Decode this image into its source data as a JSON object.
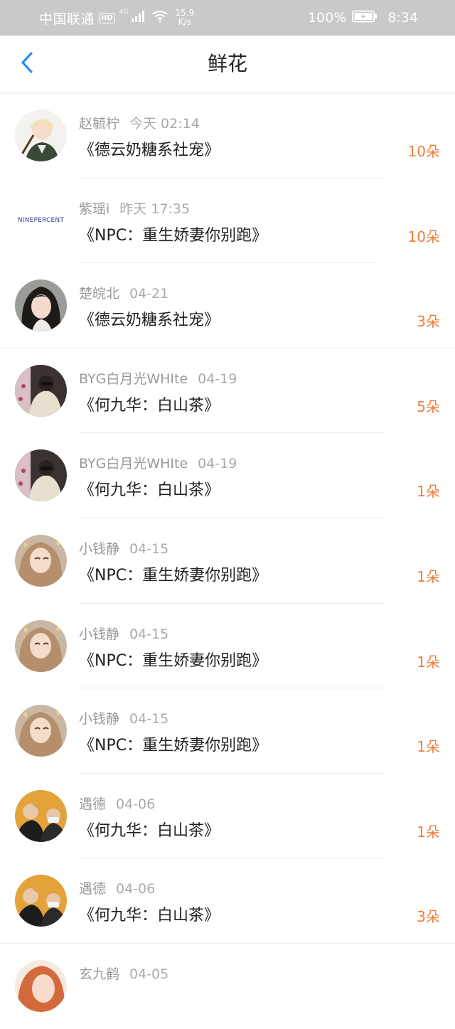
{
  "status_bar": {
    "carrier": "中国联通",
    "hd": "HD",
    "network": "4G",
    "speed_value": "15.9",
    "speed_unit": "K/s",
    "battery": "100%",
    "time": "8:34"
  },
  "header": {
    "title": "鲜花"
  },
  "colors": {
    "accent_orange": "#ee7d3a",
    "back_blue": "#2f8ef2",
    "status_bar_bg": "#c9c9c9"
  },
  "icons": {
    "back": "chevron-left-icon",
    "signal": "signal-icon",
    "wifi": "wifi-icon",
    "battery": "battery-charging-icon"
  },
  "records": [
    {
      "user": "赵毓柠",
      "time": "今天 02:14",
      "book": "《德云奶糖系社宠》",
      "count": "10朵"
    },
    {
      "user": "紫瑶i",
      "time": "昨天 17:35",
      "book": "《NPC：重生娇妻你别跑》",
      "count": "10朵",
      "logo": "NINEPERCENT"
    },
    {
      "user": "楚皖北",
      "time": "04-21",
      "book": "《德云奶糖系社宠》",
      "count": "3朵"
    },
    {
      "user": "BYG白月光WHIte",
      "time": "04-19",
      "book": "《何九华：白山茶》",
      "count": "5朵"
    },
    {
      "user": "BYG白月光WHIte",
      "time": "04-19",
      "book": "《何九华：白山茶》",
      "count": "1朵"
    },
    {
      "user": "小钱静",
      "time": "04-15",
      "book": "《NPC：重生娇妻你别跑》",
      "count": "1朵"
    },
    {
      "user": "小钱静",
      "time": "04-15",
      "book": "《NPC：重生娇妻你别跑》",
      "count": "1朵"
    },
    {
      "user": "小钱静",
      "time": "04-15",
      "book": "《NPC：重生娇妻你别跑》",
      "count": "1朵"
    },
    {
      "user": "遇德",
      "time": "04-06",
      "book": "《何九华：白山茶》",
      "count": "1朵"
    },
    {
      "user": "遇德",
      "time": "04-06",
      "book": "《何九华：白山茶》",
      "count": "3朵"
    },
    {
      "user": "玄九鹤",
      "time": "04-05",
      "book": "",
      "count": ""
    }
  ]
}
